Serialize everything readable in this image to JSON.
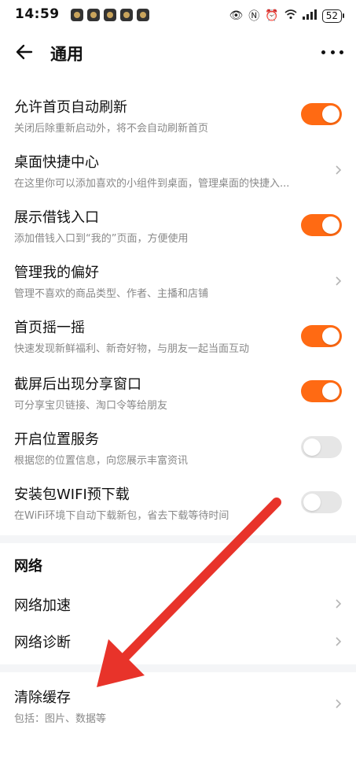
{
  "status": {
    "time": "14:59",
    "battery": "52"
  },
  "header": {
    "title": "通用"
  },
  "settings": [
    {
      "title": "允许首页自动刷新",
      "subtitle": "关闭后除重新启动外，将不会自动刷新首页",
      "control": "toggle",
      "state": "on"
    },
    {
      "title": "桌面快捷中心",
      "subtitle": "在这里你可以添加喜欢的小组件到桌面，管理桌面的快捷入...",
      "control": "chevron"
    },
    {
      "title": "展示借钱入口",
      "subtitle": "添加借钱入口到“我的”页面，方便使用",
      "control": "toggle",
      "state": "on"
    },
    {
      "title": "管理我的偏好",
      "subtitle": "管理不喜欢的商品类型、作者、主播和店铺",
      "control": "chevron"
    },
    {
      "title": "首页摇一摇",
      "subtitle": "快速发现新鲜福利、新奇好物，与朋友一起当面互动",
      "control": "toggle",
      "state": "on"
    },
    {
      "title": "截屏后出现分享窗口",
      "subtitle": "可分享宝贝链接、淘口令等给朋友",
      "control": "toggle",
      "state": "on"
    },
    {
      "title": "开启位置服务",
      "subtitle": "根据您的位置信息，向您展示丰富资讯",
      "control": "toggle",
      "state": "off"
    },
    {
      "title": "安装包WIFI预下载",
      "subtitle": "在WiFi环境下自动下载新包，省去下载等待时间",
      "control": "toggle",
      "state": "off"
    }
  ],
  "network": {
    "section_title": "网络",
    "items": [
      {
        "title": "网络加速"
      },
      {
        "title": "网络诊断"
      }
    ]
  },
  "cache": {
    "title": "清除缓存",
    "subtitle": "包括：图片、数据等"
  },
  "colors": {
    "accent": "#ff6a13",
    "annotation_arrow": "#e8332a"
  }
}
